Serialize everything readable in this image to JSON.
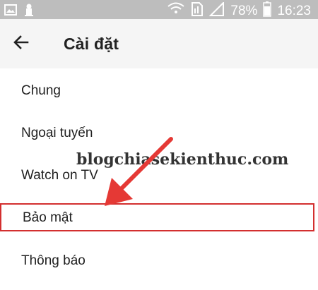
{
  "status_bar": {
    "battery_percent": "78%",
    "time": "16:23",
    "icons": [
      "gallery-icon",
      "usb-debug-icon",
      "wifi-calling-icon",
      "sim-icon",
      "signal-icon",
      "battery-icon"
    ]
  },
  "app_bar": {
    "back_icon": "arrow-left-icon",
    "title": "Cài đặt"
  },
  "settings": {
    "items": [
      {
        "label": "Chung"
      },
      {
        "label": "Ngoại tuyến"
      },
      {
        "label": "Watch on TV"
      },
      {
        "label": "Bảo mật",
        "highlighted": true
      },
      {
        "label": "Thông báo"
      }
    ]
  },
  "watermark": {
    "text": "blogchiasekienthuc.com"
  },
  "colors": {
    "status_bar": "#bdbdbd",
    "app_bar": "#f5f5f5",
    "highlight": "#d32f2f",
    "arrow": "#e53935"
  }
}
